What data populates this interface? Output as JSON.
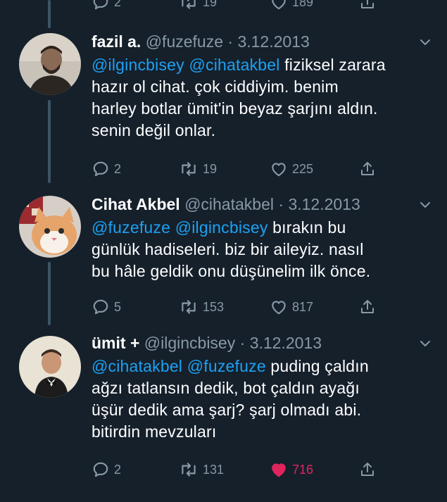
{
  "top_partial": {
    "replies": "2",
    "retweets": "19",
    "likes": "189"
  },
  "tweets": [
    {
      "name": "fazil a.",
      "handle": "@fuzefuze",
      "date": "3.12.2013",
      "mention1": "@ilgincbisey",
      "mention2": "@cihatakbel",
      "lines": [
        " fiziksel zarara",
        "hazır ol cihat. çok ciddiyim. benim",
        "harley botlar ümit'in beyaz şarjını aldın.",
        "senin değil onlar."
      ],
      "replies": "2",
      "retweets": "19",
      "likes": "225",
      "liked": false
    },
    {
      "name": "Cihat Akbel",
      "handle": "@cihatakbel",
      "date": "3.12.2013",
      "mention1": "@fuzefuze",
      "mention2": "@ilgincbisey",
      "lines": [
        " bırakın bu",
        "günlük hadiseleri. biz bir aileyiz. nasıl",
        "bu hâle geldik onu düşünelim ilk önce."
      ],
      "replies": "5",
      "retweets": "153",
      "likes": "817",
      "liked": false
    },
    {
      "name": "ümit +",
      "handle": "@ilgincbisey",
      "date": "3.12.2013",
      "mention1": "@cihatakbel",
      "mention2": "@fuzefuze",
      "lines": [
        " puding çaldın",
        "ağzı tatlansın dedik, bot çaldın ayağı",
        "üşür dedik ama şarj? şarj olmadı abi.",
        "bitirdin mevzuları"
      ],
      "replies": "2",
      "retweets": "131",
      "likes": "716",
      "liked": true
    }
  ],
  "separator": " · ",
  "colors": {
    "background": "#15202b",
    "link": "#1da1f2",
    "secondary": "#8899a6",
    "like_active": "#e0245e"
  },
  "icons": [
    "reply-icon",
    "retweet-icon",
    "like-icon",
    "share-icon",
    "caret-down-icon"
  ]
}
